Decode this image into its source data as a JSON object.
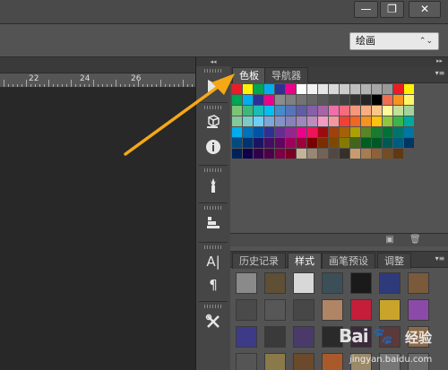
{
  "window": {
    "minimize_glyph": "—",
    "restore_glyph": "❐",
    "close_glyph": "✕"
  },
  "options_bar": {
    "workspace_value": "绘画",
    "workspace_arrow": "⌃⌄"
  },
  "ruler": {
    "labels": [
      "22",
      "24",
      "26"
    ]
  },
  "tool_strip": {
    "tools": [
      {
        "name": "play-icon"
      },
      {
        "name": "cube-icon"
      },
      {
        "name": "info-icon"
      },
      {
        "name": "brush-icon"
      },
      {
        "name": "clone-stamp-icon"
      },
      {
        "name": "character-icon",
        "glyph": "A|"
      },
      {
        "name": "paragraph-icon",
        "glyph": "¶"
      },
      {
        "name": "tools-icon"
      }
    ]
  },
  "panel_top": {
    "tabs": [
      {
        "label": "色板",
        "active": true
      },
      {
        "label": "导航器",
        "active": false
      }
    ],
    "menu_glyph": "▾≡"
  },
  "panel_bottom": {
    "tabs": [
      {
        "label": "历史记录",
        "active": false
      },
      {
        "label": "样式",
        "active": true
      },
      {
        "label": "画笔预设",
        "active": false
      },
      {
        "label": "调整",
        "active": false
      }
    ],
    "menu_glyph": "▾≡"
  },
  "swatch_colors": [
    [
      "#ed1c24",
      "#fff200",
      "#00a651",
      "#00aeef",
      "#2e3192",
      "#ec008c",
      "#ffffff",
      "#f2f2f2",
      "#e6e6e6",
      "#d9d9d9",
      "#cccccc",
      "#bfbfbf",
      "#b3b3b3",
      "#a6a6a6",
      "#999999",
      "#ed1c24",
      "#fff200"
    ],
    [
      "#00a651",
      "#00aeef",
      "#2e3192",
      "#ec008c",
      "#8c8c8c",
      "#808080",
      "#737373",
      "#666666",
      "#595959",
      "#4d4d4d",
      "#404040",
      "#333333",
      "#262626",
      "#000000",
      "#f26c4f",
      "#f7941d",
      "#fff568"
    ],
    [
      "#7cc576",
      "#3cb878",
      "#1cbbb4",
      "#00bff3",
      "#448ccb",
      "#5674b9",
      "#605ca8",
      "#855fa8",
      "#a763a8",
      "#f06eaa",
      "#f26d7d",
      "#f7977a",
      "#f9ad81",
      "#fdc689",
      "#fff79a",
      "#c4df9b",
      "#a3d39c"
    ],
    [
      "#82ca9c",
      "#7accc8",
      "#6dcff6",
      "#7da7d9",
      "#8393ca",
      "#8781bd",
      "#a186be",
      "#bd8cbf",
      "#f49ac1",
      "#f5989d",
      "#ef4136",
      "#f26522",
      "#f7941d",
      "#ffc20e",
      "#8dc63f",
      "#39b54a",
      "#00a99d"
    ],
    [
      "#00aeef",
      "#0072bc",
      "#0054a6",
      "#2e3192",
      "#662d91",
      "#92278f",
      "#ec008c",
      "#ed145b",
      "#9e0b0f",
      "#a0410d",
      "#a3620a",
      "#aba000",
      "#598527",
      "#197b30",
      "#007236",
      "#00746b",
      "#0076a3"
    ],
    [
      "#004b80",
      "#003471",
      "#1b1464",
      "#440e62",
      "#630460",
      "#9e005d",
      "#9e0039",
      "#790000",
      "#7b2e00",
      "#7d4900",
      "#827b00",
      "#406618",
      "#005e20",
      "#005826",
      "#005952",
      "#005b7f",
      "#003663"
    ],
    [
      "#002157",
      "#0d004c",
      "#32004b",
      "#4b0049",
      "#7b0046",
      "#7a0026",
      "#c7b299",
      "#998675",
      "#736357",
      "#534741",
      "#37302a",
      "#c69c6d",
      "#a67c52",
      "#8c6239",
      "#754c24",
      "#603913"
    ]
  ],
  "style_swatches": [
    [
      "#8a8a8a",
      "#5e4f35",
      "#d8d8d8",
      "#3b4f58",
      "#1a1a1a",
      "#2e3a7a",
      "#7a5a3a"
    ],
    [
      "#4a4a4a",
      "#575757",
      "#474747",
      "#b08565",
      "#c41e3a",
      "#c8a52a",
      "#8b4aa8"
    ],
    [
      "#3d3b88",
      "#3a3a3a",
      "#4a3a6a",
      "#2a2a2a",
      "#3a2a3a",
      "#5a3a3a",
      "#8a6a4a"
    ],
    [
      "#555555",
      "#8a7a4a",
      "#6a4a2a",
      "#aa5a2a",
      "#9a8a6a",
      "#777777",
      "#6a6a6a"
    ]
  ],
  "watermark": {
    "logo": "Bai",
    "logo2": "经验",
    "url": "jingyan.baidu.com"
  }
}
